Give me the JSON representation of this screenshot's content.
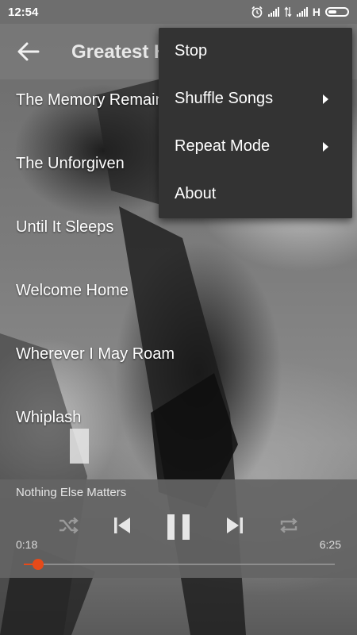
{
  "status_bar": {
    "time": "12:54",
    "network_label": "H"
  },
  "app_bar": {
    "title": "Greatest Hits",
    "icon": "arrow-back-icon"
  },
  "songs": [
    "The Memory Remains",
    "The Unforgiven",
    "Until It Sleeps",
    "Welcome Home",
    "Wherever I May Roam",
    "Whiplash"
  ],
  "menu": {
    "items": [
      {
        "label": "Stop",
        "submenu": false
      },
      {
        "label": "Shuffle Songs",
        "submenu": true
      },
      {
        "label": "Repeat Mode",
        "submenu": true
      },
      {
        "label": "About",
        "submenu": false
      }
    ]
  },
  "player": {
    "now_playing": "Nothing Else Matters",
    "current_time": "0:18",
    "duration": "6:25",
    "progress": 0.047,
    "accent_color": "#e64a19",
    "controls": [
      "shuffle-icon",
      "skip-previous-icon",
      "pause-icon",
      "skip-next-icon",
      "repeat-icon"
    ]
  }
}
